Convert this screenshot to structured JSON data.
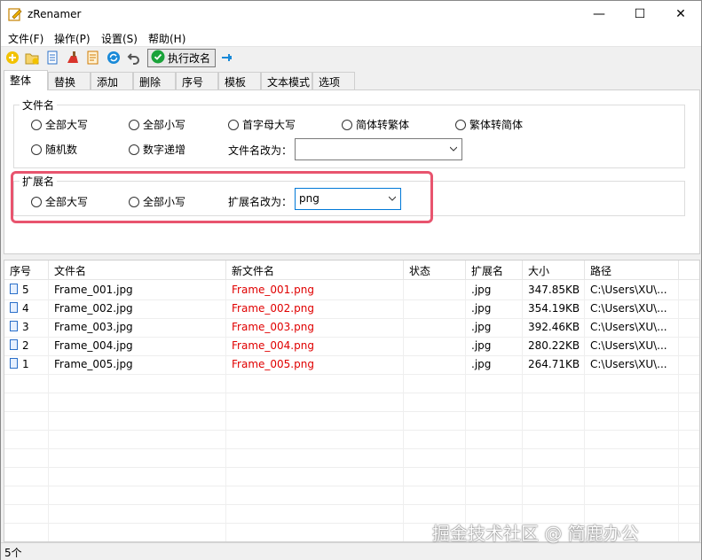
{
  "window": {
    "title": "zRenamer",
    "minimize": "—",
    "maximize": "☐",
    "close": "✕"
  },
  "menu": [
    {
      "label": "文件(F)"
    },
    {
      "label": "操作(P)"
    },
    {
      "label": "设置(S)"
    },
    {
      "label": "帮助(H)"
    }
  ],
  "toolbar": {
    "execute_label": "执行改名"
  },
  "tabs": [
    {
      "label": "整体"
    },
    {
      "label": "替换"
    },
    {
      "label": "添加"
    },
    {
      "label": "删除"
    },
    {
      "label": "序号"
    },
    {
      "label": "模板"
    },
    {
      "label": "文本模式"
    },
    {
      "label": "选项"
    }
  ],
  "filename_group": {
    "legend": "文件名",
    "radios": [
      "全部大写",
      "全部小写",
      "首字母大写",
      "简体转繁体",
      "繁体转简体",
      "随机数",
      "数字递增"
    ],
    "change_label": "文件名改为：",
    "change_value": ""
  },
  "ext_group": {
    "legend": "扩展名",
    "radios": [
      "全部大写",
      "全部小写"
    ],
    "change_label": "扩展名改为：",
    "change_value": "png"
  },
  "table": {
    "columns": [
      "序号",
      "文件名",
      "新文件名",
      "状态",
      "扩展名",
      "大小",
      "路径"
    ],
    "rows": [
      {
        "no": "5",
        "name": "Frame_001.jpg",
        "new": "Frame_001.png",
        "status": "",
        "ext": ".jpg",
        "size": "347.85KB",
        "path": "C:\\Users\\XU\\..."
      },
      {
        "no": "4",
        "name": "Frame_002.jpg",
        "new": "Frame_002.png",
        "status": "",
        "ext": ".jpg",
        "size": "354.19KB",
        "path": "C:\\Users\\XU\\..."
      },
      {
        "no": "3",
        "name": "Frame_003.jpg",
        "new": "Frame_003.png",
        "status": "",
        "ext": ".jpg",
        "size": "392.46KB",
        "path": "C:\\Users\\XU\\..."
      },
      {
        "no": "2",
        "name": "Frame_004.jpg",
        "new": "Frame_004.png",
        "status": "",
        "ext": ".jpg",
        "size": "280.22KB",
        "path": "C:\\Users\\XU\\..."
      },
      {
        "no": "1",
        "name": "Frame_005.jpg",
        "new": "Frame_005.png",
        "status": "",
        "ext": ".jpg",
        "size": "264.71KB",
        "path": "C:\\Users\\XU\\..."
      }
    ]
  },
  "status": {
    "count": "5个"
  },
  "watermark": "掘金技术社区 @ 简鹿办公",
  "colors": {
    "new_name": "#e00000",
    "highlight": "#e8546e",
    "accent": "#0078d7"
  }
}
